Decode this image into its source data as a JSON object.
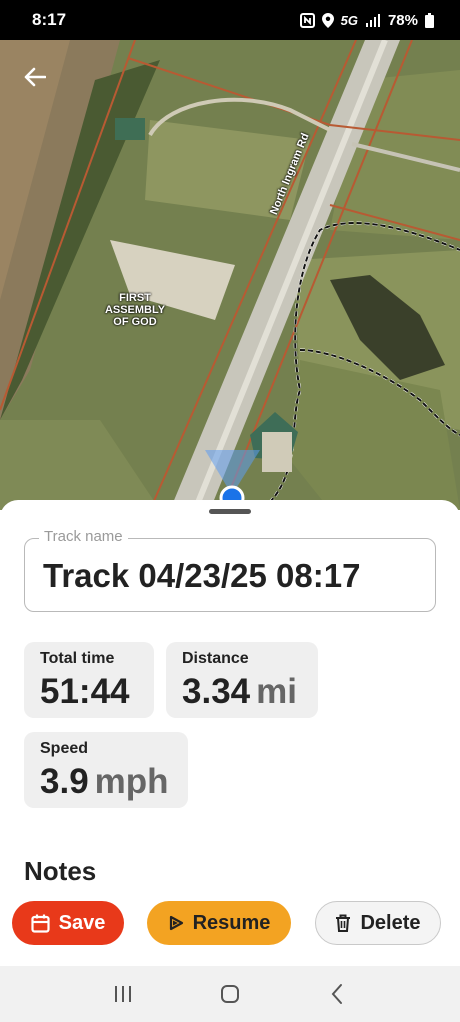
{
  "status_bar": {
    "time": "8:17",
    "network": "5G",
    "battery": "78%",
    "icons": [
      "nfc-icon",
      "location-icon",
      "signal-icon",
      "battery-icon"
    ]
  },
  "map": {
    "road_label": "North Ingram Rd",
    "place_label": "FIRST ASSEMBLY OF GOD"
  },
  "track": {
    "name_label": "Track name",
    "name_value": "Track 04/23/25 08:17"
  },
  "stats": {
    "total_time": {
      "label": "Total time",
      "value": "51:44"
    },
    "distance": {
      "label": "Distance",
      "value": "3.34",
      "unit": "mi"
    },
    "speed": {
      "label": "Speed",
      "value": "3.9",
      "unit": "mph"
    }
  },
  "notes": {
    "title": "Notes"
  },
  "actions": {
    "save_label": "Save",
    "resume_label": "Resume",
    "delete_label": "Delete"
  },
  "colors": {
    "save": "#e8391a",
    "resume": "#f3a322",
    "location_dot": "#1a73e8"
  }
}
